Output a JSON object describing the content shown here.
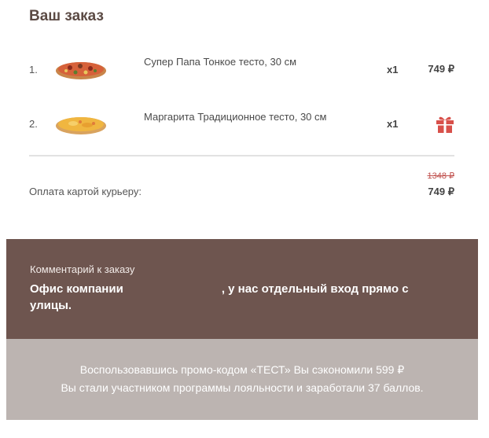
{
  "order": {
    "title": "Ваш заказ",
    "items": [
      {
        "num": "1.",
        "name": "Супер Папа Тонкое тесто, 30 см",
        "qty": "x1",
        "price": "749 ₽",
        "image": "pizza-super-papa-icon"
      },
      {
        "num": "2.",
        "name": "Маргарита Традиционное тесто, 30 см",
        "qty": "x1",
        "price_icon": "gift-icon",
        "image": "pizza-margarita-icon"
      }
    ],
    "old_total": "1348 ₽",
    "payment_label": "Оплата картой курьеру:",
    "total": "749 ₽"
  },
  "comment": {
    "label": "Комментарий к заказу",
    "text": "Офис компании                              , у нас отдельный вход прямо с улицы."
  },
  "promo": {
    "line1": "Воспользовавшись промо-кодом «ТЕСТ» Вы сэкономили 599 ₽",
    "line2": "Вы стали участником программы лояльности и заработали 37 баллов."
  },
  "colors": {
    "comment_bg": "#6e554f",
    "promo_bg": "#bcb4b1",
    "strike_red": "#c0504d",
    "gift_red": "#d8504a"
  }
}
